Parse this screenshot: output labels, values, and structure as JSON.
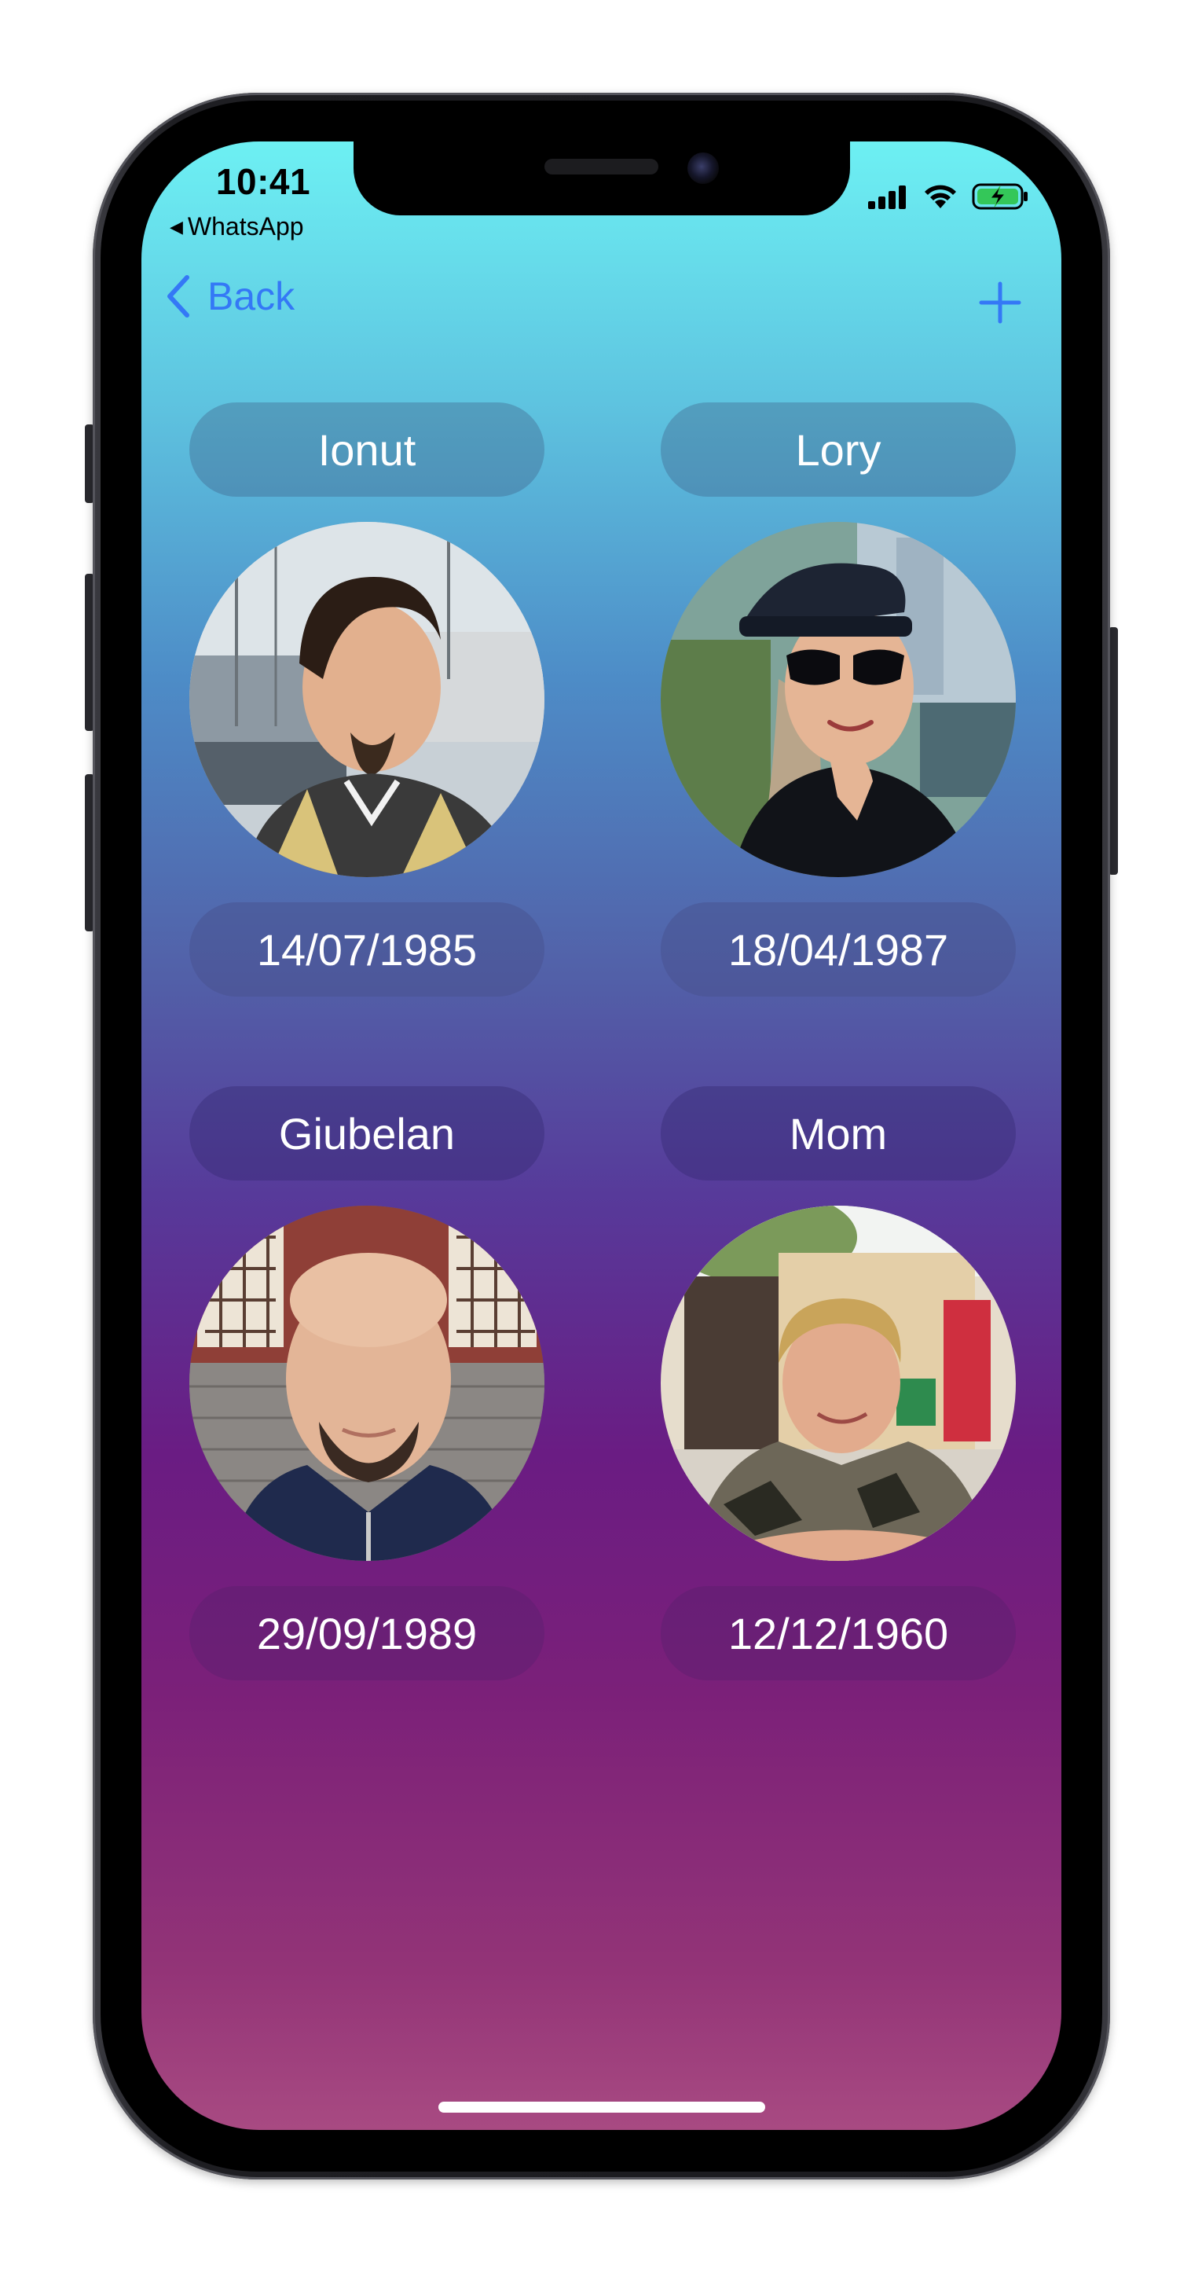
{
  "status_bar": {
    "time": "10:41",
    "back_app": "WhatsApp",
    "back_glyph": "◀"
  },
  "nav": {
    "back_label": "Back",
    "back_icon": "chevron-left-icon",
    "add_icon": "plus-icon",
    "accent_color": "#3478f6"
  },
  "contacts": [
    {
      "name": "Ionut",
      "date": "14/07/1985"
    },
    {
      "name": "Lory",
      "date": "18/04/1987"
    },
    {
      "name": "Giubelan",
      "date": "29/09/1989"
    },
    {
      "name": "Mom",
      "date": "12/12/1960"
    }
  ],
  "theme": {
    "gradient_top": "#6df0f3",
    "gradient_middle": "#573a9a",
    "gradient_bottom": "#a84a82"
  }
}
